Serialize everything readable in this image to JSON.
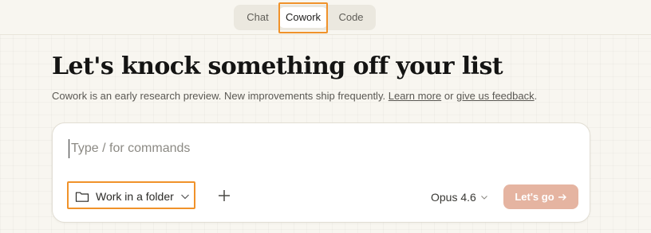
{
  "tabs": {
    "chat": "Chat",
    "cowork": "Cowork",
    "code": "Code",
    "active": "cowork"
  },
  "hero": {
    "title": "Let's knock something off your list",
    "subtitle_prefix": "Cowork is an early research preview. New improvements ship frequently.",
    "learn_more": "Learn more",
    "or_text": "or",
    "feedback": "give us feedback",
    "period": "."
  },
  "composer": {
    "placeholder": "Type / for commands",
    "value": "",
    "folder_button": "Work in a folder",
    "model": "Opus 4.6",
    "submit": "Let's go"
  },
  "colors": {
    "accent_highlight": "#f0922a",
    "submit_bg": "#e5b4a1",
    "background": "#f8f6f0"
  },
  "icons": {
    "folder": "folder-icon",
    "dropdown": "chevron-down-icon",
    "add": "plus-icon",
    "submit": "arrow-right-icon"
  }
}
